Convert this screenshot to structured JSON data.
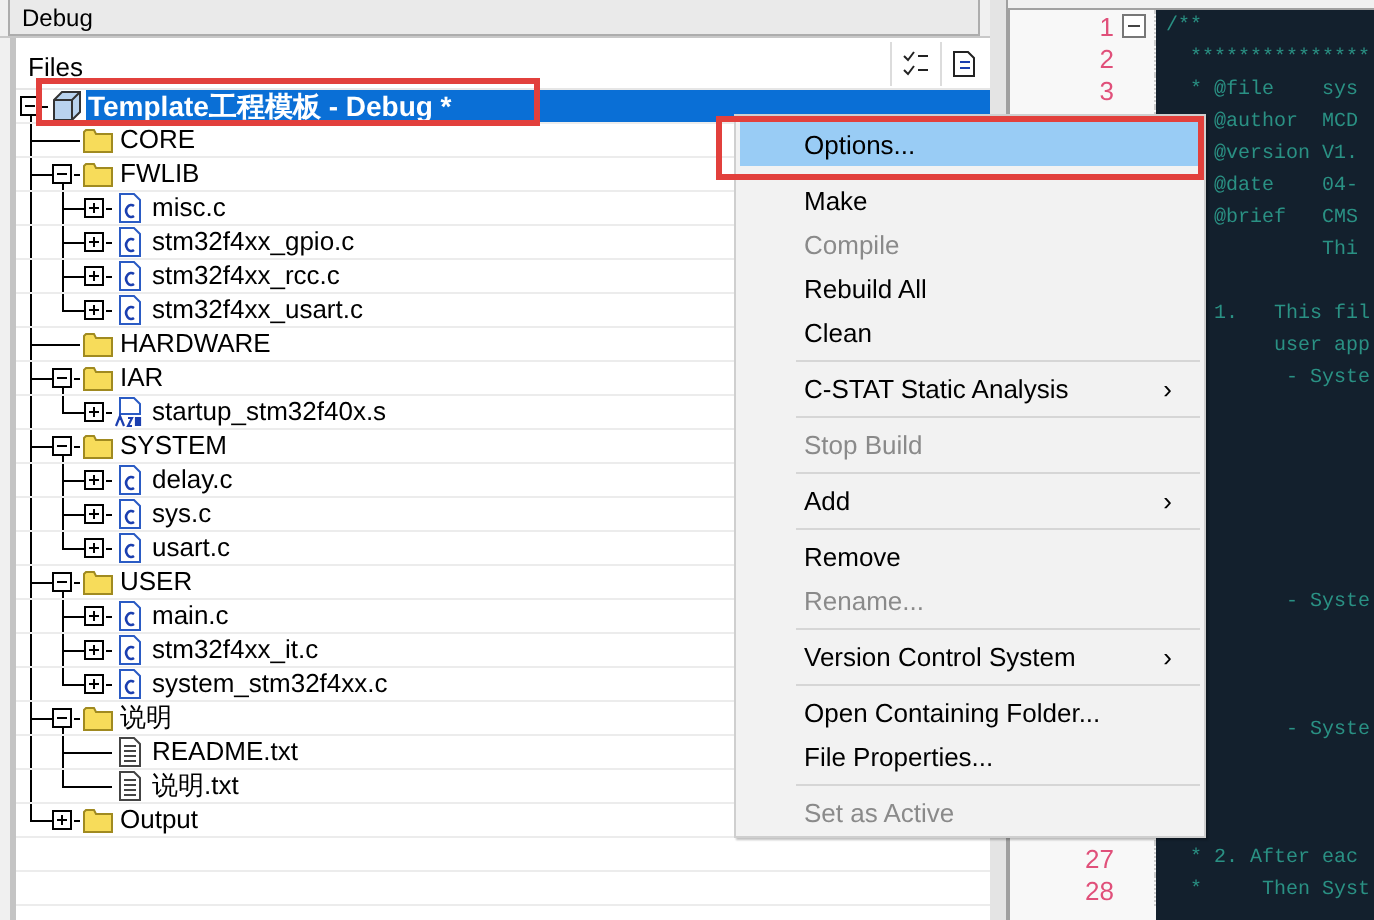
{
  "toolbar": {
    "configuration": "Debug"
  },
  "workspace": {
    "header": "Files",
    "tree": [
      {
        "label": "Template工程模板 - Debug *",
        "kind": "project",
        "expanded": true,
        "selected": true,
        "annotated": true,
        "children": [
          {
            "label": "CORE",
            "kind": "folder",
            "selected": false
          },
          {
            "label": "FWLIB",
            "kind": "folder",
            "expanded": true,
            "selected": false,
            "children": [
              {
                "label": "misc.c",
                "kind": "c-file",
                "expanded": false,
                "selected": false
              },
              {
                "label": "stm32f4xx_gpio.c",
                "kind": "c-file",
                "expanded": false,
                "selected": false
              },
              {
                "label": "stm32f4xx_rcc.c",
                "kind": "c-file",
                "expanded": false,
                "selected": false
              },
              {
                "label": "stm32f4xx_usart.c",
                "kind": "c-file",
                "expanded": false,
                "selected": false
              }
            ]
          },
          {
            "label": "HARDWARE",
            "kind": "folder",
            "selected": false
          },
          {
            "label": "IAR",
            "kind": "folder",
            "expanded": true,
            "selected": false,
            "children": [
              {
                "label": "startup_stm32f40x.s",
                "kind": "asm-file",
                "expanded": false,
                "selected": false
              }
            ]
          },
          {
            "label": "SYSTEM",
            "kind": "folder",
            "expanded": true,
            "selected": false,
            "children": [
              {
                "label": "delay.c",
                "kind": "c-file",
                "expanded": false,
                "selected": false
              },
              {
                "label": "sys.c",
                "kind": "c-file",
                "expanded": false,
                "selected": false
              },
              {
                "label": "usart.c",
                "kind": "c-file",
                "expanded": false,
                "selected": false
              }
            ]
          },
          {
            "label": "USER",
            "kind": "folder",
            "expanded": true,
            "selected": false,
            "children": [
              {
                "label": "main.c",
                "kind": "c-file",
                "expanded": false,
                "selected": false
              },
              {
                "label": "stm32f4xx_it.c",
                "kind": "c-file",
                "expanded": false,
                "selected": false
              },
              {
                "label": "system_stm32f4xx.c",
                "kind": "c-file",
                "expanded": false,
                "selected": false
              }
            ]
          },
          {
            "label": "说明",
            "kind": "folder",
            "expanded": true,
            "selected": false,
            "children": [
              {
                "label": "README.txt",
                "kind": "text-file",
                "selected": false
              },
              {
                "label": "说明.txt",
                "kind": "text-file",
                "selected": false
              }
            ]
          },
          {
            "label": "Output",
            "kind": "folder",
            "expanded": false,
            "selected": false
          }
        ]
      }
    ]
  },
  "editor": {
    "lines": [
      {
        "kind": "code",
        "number": "1",
        "text": "/**",
        "fold": true
      },
      {
        "kind": "code",
        "number": "2",
        "text": "  ***************"
      },
      {
        "kind": "code",
        "number": "3",
        "text": "  * @file    sys"
      },
      {
        "kind": "code",
        "text": "    @author  MCD"
      },
      {
        "kind": "code",
        "text": "    @version V1."
      },
      {
        "kind": "code",
        "text": "    @date    04-"
      },
      {
        "kind": "code",
        "text": "    @brief   CMS"
      },
      {
        "kind": "code",
        "text": "             Thi"
      },
      {
        "kind": "blank"
      },
      {
        "kind": "code",
        "text": "    1.   This fil"
      },
      {
        "kind": "code",
        "text": "         user app"
      },
      {
        "kind": "code",
        "text": "          - Syste"
      },
      {
        "kind": "blank"
      },
      {
        "kind": "blank"
      },
      {
        "kind": "blank"
      },
      {
        "kind": "blank"
      },
      {
        "kind": "blank"
      },
      {
        "kind": "blank"
      },
      {
        "kind": "code",
        "text": "          - Syste"
      },
      {
        "kind": "blank"
      },
      {
        "kind": "blank"
      },
      {
        "kind": "blank"
      },
      {
        "kind": "code",
        "text": "          - Syste"
      },
      {
        "kind": "blank"
      },
      {
        "kind": "blank"
      },
      {
        "kind": "blank"
      },
      {
        "kind": "code",
        "number": "27",
        "text": "  * 2. After eac"
      },
      {
        "kind": "code",
        "number": "28",
        "text": "  *     Then Syst"
      }
    ]
  },
  "context_menu": {
    "items": [
      {
        "kind": "item",
        "label": "Options...",
        "disabled": false,
        "selected": true,
        "annotated": true
      },
      {
        "kind": "item",
        "label": "Make",
        "disabled": false,
        "selected": false
      },
      {
        "kind": "item",
        "label": "Compile",
        "disabled": true,
        "selected": false
      },
      {
        "kind": "item",
        "label": "Rebuild All",
        "disabled": false,
        "selected": false
      },
      {
        "kind": "item",
        "label": "Clean",
        "disabled": false,
        "selected": false
      },
      {
        "kind": "separator"
      },
      {
        "kind": "item",
        "label": "C-STAT Static Analysis",
        "arrow": "›",
        "disabled": false,
        "selected": false
      },
      {
        "kind": "separator"
      },
      {
        "kind": "item",
        "label": "Stop Build",
        "disabled": true,
        "selected": false
      },
      {
        "kind": "separator"
      },
      {
        "kind": "item",
        "label": "Add",
        "arrow": "›",
        "disabled": false,
        "selected": false
      },
      {
        "kind": "separator"
      },
      {
        "kind": "item",
        "label": "Remove",
        "disabled": false,
        "selected": false
      },
      {
        "kind": "item",
        "label": "Rename...",
        "disabled": true,
        "selected": false
      },
      {
        "kind": "separator"
      },
      {
        "kind": "item",
        "label": "Version Control System",
        "arrow": "›",
        "disabled": false,
        "selected": false
      },
      {
        "kind": "separator"
      },
      {
        "kind": "item",
        "label": "Open Containing Folder...",
        "disabled": false,
        "selected": false
      },
      {
        "kind": "item",
        "label": "File Properties...",
        "disabled": false,
        "selected": false
      },
      {
        "kind": "separator"
      },
      {
        "kind": "item",
        "label": "Set as Active",
        "disabled": true,
        "selected": false
      }
    ]
  }
}
